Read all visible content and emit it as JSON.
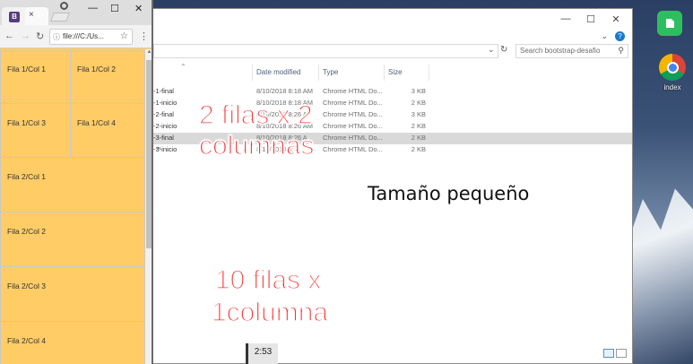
{
  "explorer": {
    "search_placeholder": "Search bootstrap-desafio",
    "columns": {
      "name": "",
      "date": "Date modified",
      "type": "Type",
      "size": "Size"
    },
    "files": [
      {
        "name": "-1-final",
        "date": "8/10/2018 8:18 AM",
        "type": "Chrome HTML Do...",
        "size": "3 KB"
      },
      {
        "name": "-1-inicio",
        "date": "8/10/2018 8:18 AM",
        "type": "Chrome HTML Do...",
        "size": "2 KB"
      },
      {
        "name": "-2-final",
        "date": "8/10/2018 8:26 A",
        "type": "Chrome HTML Do...",
        "size": "3 KB"
      },
      {
        "name": "-2-inicio",
        "date": "8/10/2018 8:26 AM",
        "type": "Chrome HTML Do...",
        "size": "2 KB"
      },
      {
        "name": "-3-final",
        "date": "8/10/2018 8:26 A",
        "type": "Chrome HTML Do...",
        "size": "2 KB",
        "selected": true
      },
      {
        "name": "-3-inicio",
        "date": "8/10/2018 8:2",
        "type": "Chrome HTML Do...",
        "size": "2 KB"
      }
    ]
  },
  "chrome_window": {
    "tab_favicon_letter": "B",
    "tab_close": "×",
    "address": "file:///C:/Us...",
    "window_controls": {
      "minimize": "—",
      "maximize": "☐",
      "close": "✕"
    }
  },
  "page_cells": [
    {
      "label": "Fila 1/Col 1"
    },
    {
      "label": "Fila 1/Col 2"
    },
    {
      "label": "Fila 1/Col 3"
    },
    {
      "label": "Fila 1/Col 4"
    },
    {
      "label": "Fila 2/Col 1"
    },
    {
      "label": "Fila 2/Col 2"
    },
    {
      "label": "Fila 2/Col 3"
    },
    {
      "label": "Fila 2/Col 4"
    }
  ],
  "desktop": {
    "chrome_shortcut_label": "index"
  },
  "annotations": {
    "grid_note_line1": "2 filas x 2",
    "grid_note_line2": "columnas",
    "size_note": "Tamaño pequeño",
    "stack_note_line1": "10 filas x",
    "stack_note_line2": "1columna"
  },
  "video": {
    "timestamp": "2:53"
  },
  "colors": {
    "page_bg": "#ffcc66",
    "annotation_red": "#ff3030"
  }
}
